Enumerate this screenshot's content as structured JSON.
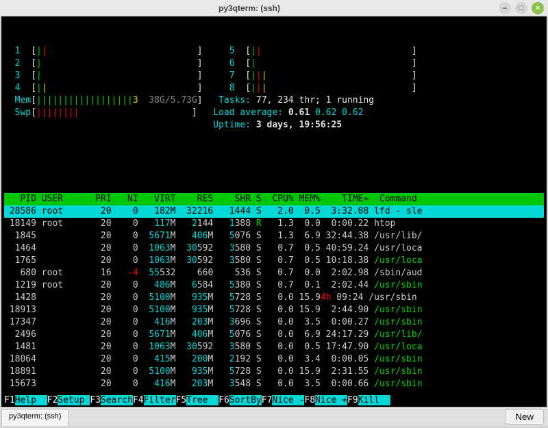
{
  "window": {
    "title": "py3qterm: (ssh)"
  },
  "cpus_left": [
    {
      "n": "1",
      "bars": [
        {
          "c": "green",
          "t": "|"
        },
        {
          "c": "red",
          "t": "|"
        }
      ]
    },
    {
      "n": "2",
      "bars": [
        {
          "c": "green",
          "t": "|"
        }
      ]
    },
    {
      "n": "3",
      "bars": [
        {
          "c": "green",
          "t": "|"
        }
      ]
    },
    {
      "n": "4",
      "bars": [
        {
          "c": "green",
          "t": "|"
        },
        {
          "c": "yellow",
          "t": "|"
        }
      ]
    }
  ],
  "cpus_right": [
    {
      "n": "5",
      "bars": [
        {
          "c": "green",
          "t": "|"
        },
        {
          "c": "red",
          "t": "|"
        }
      ]
    },
    {
      "n": "6",
      "bars": [
        {
          "c": "green",
          "t": "|"
        }
      ]
    },
    {
      "n": "7",
      "bars": [
        {
          "c": "green",
          "t": "|"
        },
        {
          "c": "red",
          "t": "|"
        },
        {
          "c": "yellow",
          "t": "|"
        }
      ]
    },
    {
      "n": "8",
      "bars": [
        {
          "c": "green",
          "t": "|"
        },
        {
          "c": "red",
          "t": "|"
        },
        {
          "c": "yellow",
          "t": "|"
        }
      ]
    }
  ],
  "mem": {
    "label": "Mem",
    "bars": "||||||||||||||||||",
    "extra": "3",
    "val": "38G/5.73G"
  },
  "swp": {
    "label": "Swp",
    "bars": "||||||||"
  },
  "tasks": {
    "label": "Tasks: ",
    "val": "77, 234 thr; 1 running"
  },
  "load": {
    "label": "Load average: ",
    "v1": "0.61",
    "v2": "0.62",
    "v3": "0.62"
  },
  "uptime": {
    "label": "Uptime: ",
    "val": "3 days, 19:56:25"
  },
  "headers": {
    "pid": "PID",
    "user": "USER",
    "pri": "PRI",
    "ni": "NI",
    "virt": "VIRT",
    "res": "RES",
    "shr": "SHR",
    "s": "S",
    "cpu": "CPU%",
    "mem": "MEM%",
    "time": "TIME+",
    "cmd": "Command"
  },
  "rows": [
    {
      "sel": true,
      "pid": "28586",
      "user": "root",
      "pri": "20",
      "ni": "0",
      "virt": "182M",
      "res": "32216",
      "shr": "1444",
      "s": "S",
      "cpu": "2.0",
      "mem": "0.5",
      "time": "3:32.08",
      "cmd": "lfd - sle",
      "cmdclass": ""
    },
    {
      "pid": "18149",
      "user": "root",
      "pri": "20",
      "ni": "0",
      "virt": "117M",
      "res": "2144",
      "shr": "1388",
      "s": "R",
      "sclass": "green",
      "cpu": "1.3",
      "mem": "0.0",
      "time": "0:00.22",
      "cmd": "htop"
    },
    {
      "pid": " 1845",
      "user": "",
      "pri": "20",
      "ni": "0",
      "virt": "5671M",
      "res": "406M",
      "shr": "5076",
      "s": "S",
      "cpu": "1.3",
      "mem": "6.9",
      "time": "32:44.38",
      "cmd": "/usr/lib/"
    },
    {
      "pid": " 1464",
      "user": "",
      "pri": "20",
      "ni": "0",
      "virt": "1063M",
      "res": "30592",
      "shr": "3580",
      "s": "S",
      "cpu": "0.7",
      "mem": "0.5",
      "time": "40:59.24",
      "cmd": "/usr/loca"
    },
    {
      "pid": " 1765",
      "user": "",
      "pri": "20",
      "ni": "0",
      "virt": "1063M",
      "res": "30592",
      "shr": "3580",
      "s": "S",
      "cpu": "0.7",
      "mem": "0.5",
      "time": "10:18.38",
      "cmd": "/usr/loca",
      "cmdclass": "green"
    },
    {
      "pid": "  680",
      "user": "root",
      "pri": "16",
      "ni": "-4",
      "niclass": "red",
      "virt": "55532",
      "res": "660",
      "shr": "536",
      "s": "S",
      "cpu": "0.7",
      "mem": "0.0",
      "time": "2:02.98",
      "cmd": "/sbin/aud"
    },
    {
      "pid": " 1219",
      "user": "root",
      "pri": "20",
      "ni": "0",
      "virt": "486M",
      "res": "6584",
      "shr": "5380",
      "s": "S",
      "cpu": "0.7",
      "mem": "0.1",
      "time": "2:02.44",
      "cmd": "/usr/sbin",
      "cmdclass": "green"
    },
    {
      "pid": " 1428",
      "user": "",
      "pri": "20",
      "ni": "0",
      "virt": "5100M",
      "res": "935M",
      "shr": "5728",
      "s": "S",
      "cpu": "0.0",
      "mem": "15.9",
      "time_pre": "4h",
      "time": "09:24",
      "cmd": "/usr/sbin"
    },
    {
      "pid": "18913",
      "user": "",
      "pri": "20",
      "ni": "0",
      "virt": "5100M",
      "res": "935M",
      "shr": "5728",
      "s": "S",
      "cpu": "0.0",
      "mem": "15.9",
      "time": "2:44.90",
      "cmd": "/usr/sbin",
      "cmdclass": "green"
    },
    {
      "pid": "17347",
      "user": "",
      "pri": "20",
      "ni": "0",
      "virt": "416M",
      "res": "203M",
      "shr": "3696",
      "s": "S",
      "cpu": "0.0",
      "mem": "3.5",
      "time": "0:00.27",
      "cmd": "/usr/sbin",
      "cmdclass": "green"
    },
    {
      "pid": " 2496",
      "user": "",
      "pri": "20",
      "ni": "0",
      "virt": "5671M",
      "res": "406M",
      "shr": "5076",
      "s": "S",
      "cpu": "0.0",
      "mem": "6.9",
      "time": "24:17.29",
      "cmd": "/usr/lib/",
      "cmdclass": "green"
    },
    {
      "pid": " 1481",
      "user": "",
      "pri": "20",
      "ni": "0",
      "virt": "1063M",
      "res": "30592",
      "shr": "3580",
      "s": "S",
      "cpu": "0.0",
      "mem": "0.5",
      "time": "17:47.90",
      "cmd": "/usr/loca",
      "cmdclass": "green"
    },
    {
      "pid": "18064",
      "user": "",
      "pri": "20",
      "ni": "0",
      "virt": "415M",
      "res": "200M",
      "shr": "2192",
      "s": "S",
      "cpu": "0.0",
      "mem": "3.4",
      "time": "0:00.05",
      "cmd": "/usr/sbin",
      "cmdclass": "green"
    },
    {
      "pid": "18891",
      "user": "",
      "pri": "20",
      "ni": "0",
      "virt": "5100M",
      "res": "935M",
      "shr": "5728",
      "s": "S",
      "cpu": "0.0",
      "mem": "15.9",
      "time": "2:31.55",
      "cmd": "/usr/sbin",
      "cmdclass": "green"
    },
    {
      "pid": "15673",
      "user": "",
      "pri": "20",
      "ni": "0",
      "virt": "416M",
      "res": "203M",
      "shr": "3548",
      "s": "S",
      "cpu": "0.0",
      "mem": "3.5",
      "time": "0:00.66",
      "cmd": "/usr/sbin",
      "cmdclass": "green"
    }
  ],
  "fnkeys": [
    {
      "k": "F1",
      "l": "Help  "
    },
    {
      "k": "F2",
      "l": "Setup "
    },
    {
      "k": "F3",
      "l": "Search"
    },
    {
      "k": "F4",
      "l": "Filter"
    },
    {
      "k": "F5",
      "l": "Tree  "
    },
    {
      "k": "F6",
      "l": "SortBy"
    },
    {
      "k": "F7",
      "l": "Nice -"
    },
    {
      "k": "F8",
      "l": "Nice +"
    },
    {
      "k": "F9",
      "l": "Kill  "
    }
  ],
  "tabs": {
    "tab0": "py3qterm: (ssh)",
    "new": "New"
  }
}
